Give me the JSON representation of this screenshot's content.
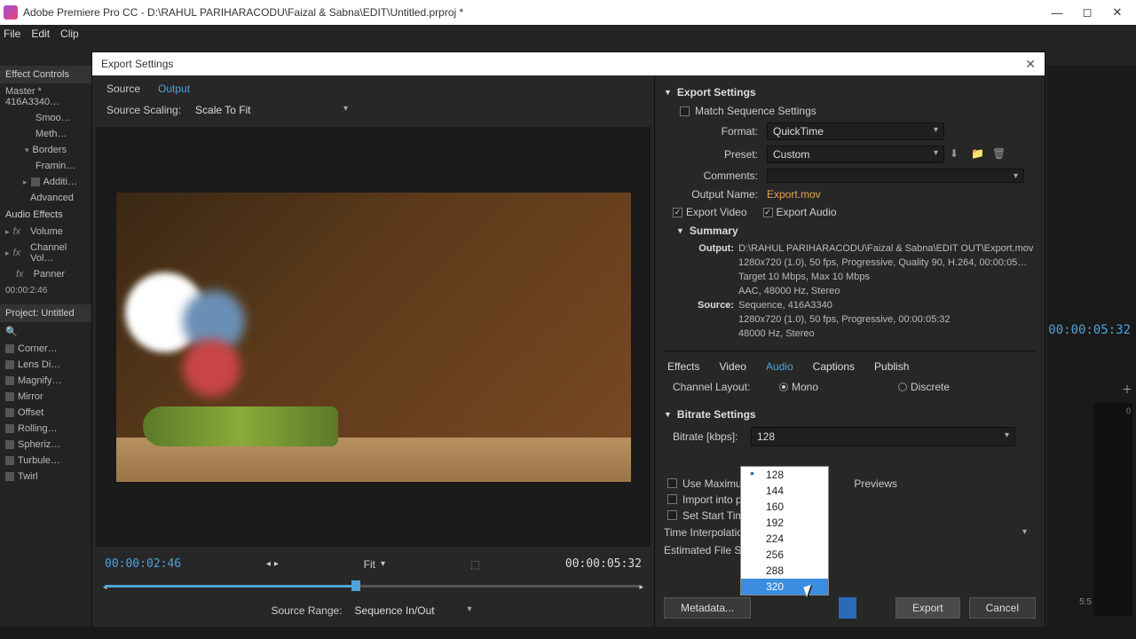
{
  "window": {
    "title": "Adobe Premiere Pro CC - D:\\RAHUL PARIHARACODU\\Faizal & Sabna\\EDIT\\Untitled.prproj *"
  },
  "menubar": [
    "File",
    "Edit",
    "Clip"
  ],
  "left_panel": {
    "effect_controls": "Effect Controls",
    "master": "Master * 416A3340…",
    "items_top": [
      "Smoo…",
      "Meth…",
      "Borders",
      "Framin…",
      "Additi…",
      "Advanced"
    ],
    "audio_effects": "Audio Effects",
    "audio_items": [
      "Volume",
      "Channel Vol…",
      "Panner"
    ],
    "mini_tc": "00:00:2:46",
    "project": "Project: Untitled",
    "fx_items": [
      "Corner…",
      "Lens Di…",
      "Magnify…",
      "Mirror",
      "Offset",
      "Rolling…",
      "Spheriz…",
      "Turbule…",
      "Twirl"
    ]
  },
  "dialog": {
    "title": "Export Settings",
    "tabs": {
      "source": "Source",
      "output": "Output"
    },
    "source_scaling_label": "Source Scaling:",
    "source_scaling_value": "Scale To Fit",
    "tc_left": "00:00:02:46",
    "tc_right": "00:00:05:32",
    "fit_label": "Fit",
    "source_range_label": "Source Range:",
    "source_range_value": "Sequence In/Out"
  },
  "settings": {
    "header": "Export Settings",
    "match_seq": "Match Sequence Settings",
    "format_label": "Format:",
    "format_value": "QuickTime",
    "preset_label": "Preset:",
    "preset_value": "Custom",
    "comments_label": "Comments:",
    "output_name_label": "Output Name:",
    "output_name_value": "Export.mov",
    "export_video": "Export Video",
    "export_audio": "Export Audio",
    "summary_header": "Summary",
    "summary": {
      "output_label": "Output:",
      "output_lines": [
        "D:\\RAHUL PARIHARACODU\\Faizal & Sabna\\EDIT OUT\\Export.mov",
        "1280x720 (1.0), 50 fps, Progressive, Quality 90, H.264, 00:00:05…",
        "Target 10 Mbps, Max 10 Mbps",
        "AAC, 48000 Hz, Stereo"
      ],
      "source_label": "Source:",
      "source_lines": [
        "Sequence, 416A3340",
        "1280x720 (1.0), 50 fps, Progressive, 00:00:05:32",
        "48000 Hz, Stereo"
      ]
    },
    "tabs": {
      "effects": "Effects",
      "video": "Video",
      "audio": "Audio",
      "captions": "Captions",
      "publish": "Publish"
    },
    "channel_layout_label": "Channel Layout:",
    "channel_mono": "Mono",
    "channel_discrete": "Discrete",
    "bitrate_header": "Bitrate Settings",
    "bitrate_label": "Bitrate [kbps]:",
    "bitrate_value": "128",
    "bitrate_options": [
      "128",
      "144",
      "160",
      "192",
      "224",
      "256",
      "288",
      "320"
    ],
    "use_max_render": "Use Maximum Re…",
    "use_previews": "Previews",
    "import_project": "Import into proje…",
    "set_start_tc": "Set Start Timeco…",
    "time_interp_label": "Time Interpolation:",
    "est_filesize_label": "Estimated File Size:",
    "metadata_btn": "Metadata...",
    "export_btn": "Export",
    "cancel_btn": "Cancel"
  },
  "right": {
    "tc": "00:00:05:32",
    "ruler": "5:5"
  }
}
